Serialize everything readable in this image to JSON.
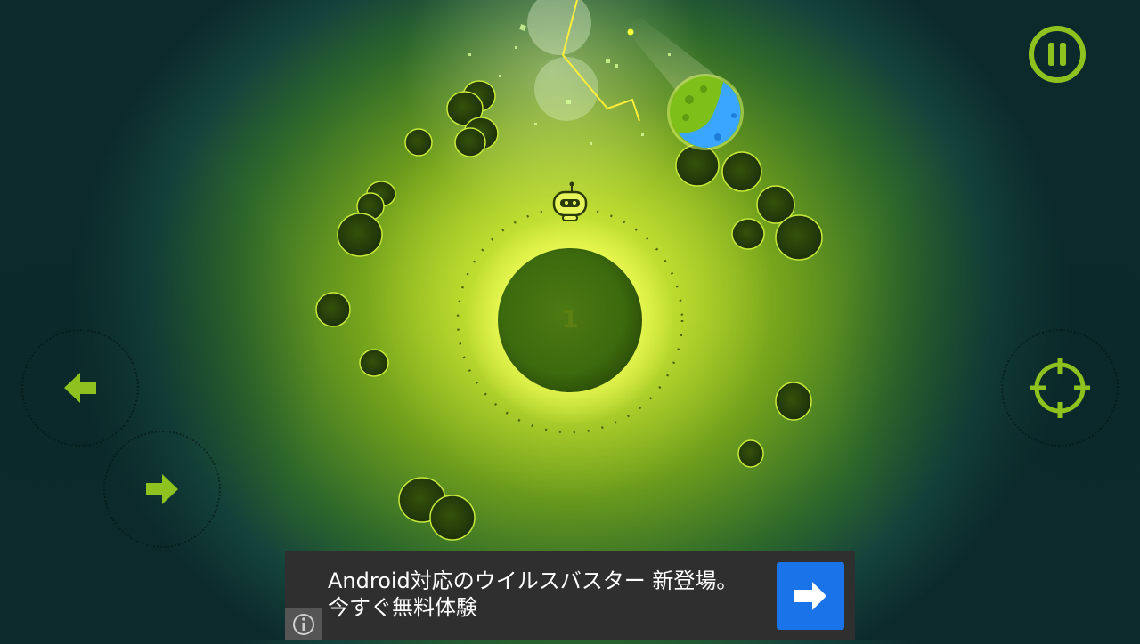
{
  "game": {
    "planet_number": "1",
    "colors": {
      "accent": "#8dc21f",
      "rock": "#2d4a05",
      "glow": "#e8ff4a",
      "water": "#3aa6ff"
    },
    "icons": {
      "pause": "pause-icon",
      "left": "arrow-left-icon",
      "right": "arrow-right-icon",
      "fire": "crosshair-icon",
      "player": "robot-icon"
    }
  },
  "ad": {
    "line1": "Android対応のウイルスバスター 新登場。",
    "line2": "今すぐ無料体験",
    "cta_icon": "arrow-right-icon",
    "info_icon": "info-icon",
    "colors": {
      "background": "#2f2f2f",
      "cta": "#1a73e8"
    }
  }
}
